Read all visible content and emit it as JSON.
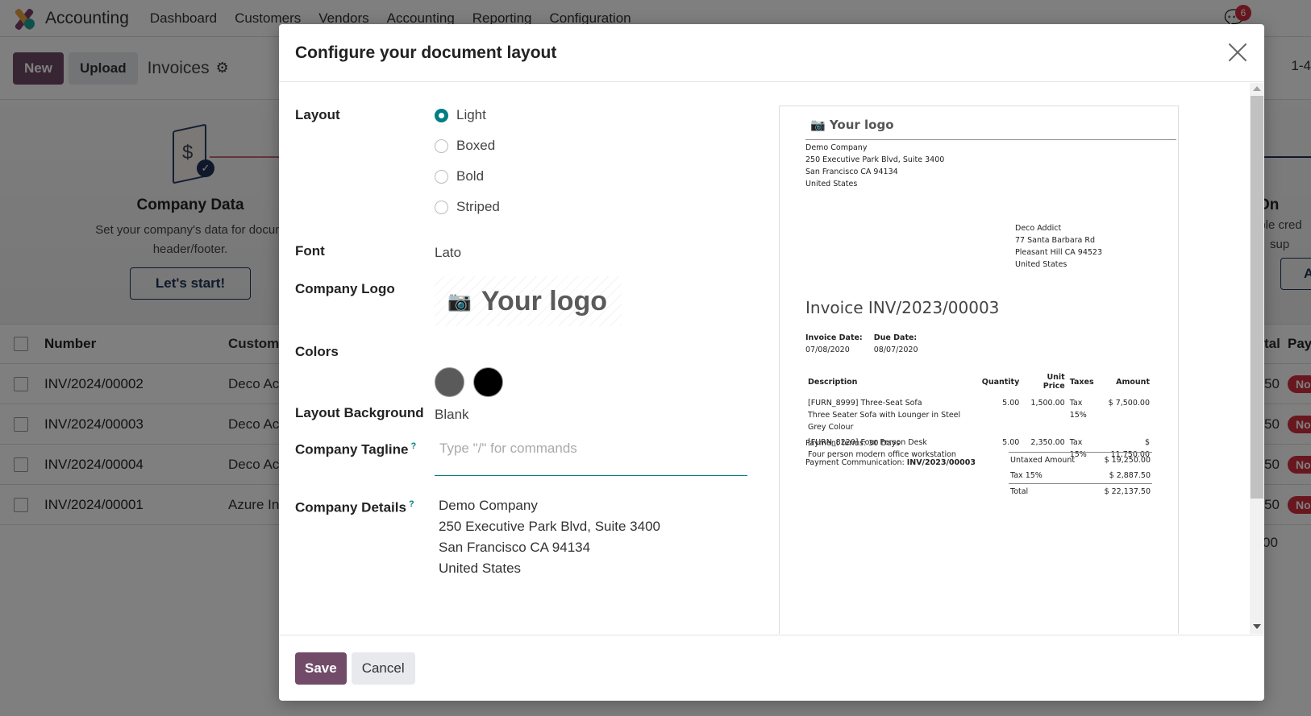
{
  "app": {
    "name": "Accounting",
    "nav": [
      "Dashboard",
      "Customers",
      "Vendors",
      "Accounting",
      "Reporting",
      "Configuration"
    ],
    "chat_badge": "6",
    "buttons": {
      "new": "New",
      "upload": "Upload"
    },
    "breadcrumb": "Invoices",
    "pager": "1-4",
    "onboarding": {
      "step1": {
        "title": "Company Data",
        "desc_line1": "Set your company's data for docum",
        "desc_line2": "header/footer.",
        "button": "Let's start!"
      },
      "step_right": {
        "title": "On",
        "desc_line1": "able cred",
        "desc_line2": "sup",
        "button": "A"
      }
    },
    "list": {
      "headers": {
        "number": "Number",
        "customer": "Custom",
        "total": "tal",
        "payment": "Pay"
      },
      "rows": [
        {
          "number": "INV/2024/00002",
          "customer": "Deco Ac",
          "total": "50",
          "payment": "No"
        },
        {
          "number": "INV/2024/00003",
          "customer": "Deco Ac",
          "total": "50",
          "payment": "No"
        },
        {
          "number": "INV/2024/00004",
          "customer": "Deco Ac",
          "total": "50",
          "payment": "No"
        },
        {
          "number": "INV/2024/00001",
          "customer": "Azure In",
          "total": "50",
          "payment": "No"
        }
      ],
      "footer_total": "00"
    }
  },
  "modal": {
    "title": "Configure your document layout",
    "fields": {
      "layout_label": "Layout",
      "layout_options": [
        {
          "label": "Light",
          "checked": true
        },
        {
          "label": "Boxed",
          "checked": false
        },
        {
          "label": "Bold",
          "checked": false
        },
        {
          "label": "Striped",
          "checked": false
        }
      ],
      "font_label": "Font",
      "font_value": "Lato",
      "logo_label": "Company Logo",
      "logo_text": "Your logo",
      "colors_label": "Colors",
      "colors": [
        "#5a5a5a",
        "#000000"
      ],
      "background_label": "Layout Background",
      "background_value": "Blank",
      "tagline_label": "Company Tagline",
      "tagline_placeholder": "Type \"/\" for commands",
      "details_label": "Company Details",
      "help_mark": "?",
      "details_lines": [
        "Demo Company",
        "250 Executive Park Blvd, Suite 3400",
        "San Francisco CA 94134",
        "United States"
      ]
    },
    "preview": {
      "logo_text": "Your logo",
      "company_lines": [
        "Demo Company",
        "250 Executive Park Blvd, Suite 3400",
        "San Francisco CA 94134",
        "United States"
      ],
      "customer_lines": [
        "Deco Addict",
        "77 Santa Barbara Rd",
        "Pleasant Hill CA 94523",
        "United States"
      ],
      "invoice_title": "Invoice INV/2023/00003",
      "invoice_date_label": "Invoice Date:",
      "invoice_date": "07/08/2020",
      "due_date_label": "Due Date:",
      "due_date": "08/07/2020",
      "table_headers": [
        "Description",
        "Quantity",
        "Unit Price",
        "Taxes",
        "Amount"
      ],
      "lines": [
        {
          "name": "[FURN_8999] Three-Seat Sofa",
          "desc": "Three Seater Sofa with Lounger in Steel Grey Colour",
          "qty": "5.00",
          "price": "1,500.00",
          "tax": "Tax 15%",
          "amount": "$ 7,500.00"
        },
        {
          "name": "[FURN_8220] Four Person Desk",
          "desc": "Four person modern office workstation",
          "qty": "5.00",
          "price": "2,350.00",
          "tax": "Tax 15%",
          "amount": "$ 11,750.00"
        }
      ],
      "payment_terms": "Payment terms: 30 Days",
      "payment_comm_label": "Payment Communication: ",
      "payment_comm_value": "INV/2023/00003",
      "totals": [
        {
          "label": "Untaxed Amount",
          "value": "$ 19,250.00"
        },
        {
          "label": "Tax 15%",
          "value": "$ 2,887.50"
        },
        {
          "label": "Total",
          "value": "$ 22,137.50"
        }
      ]
    },
    "footer": {
      "save": "Save",
      "cancel": "Cancel"
    }
  },
  "colors": {
    "primary": "#714b67",
    "accent": "#017e84",
    "danger": "#d22e3e"
  }
}
